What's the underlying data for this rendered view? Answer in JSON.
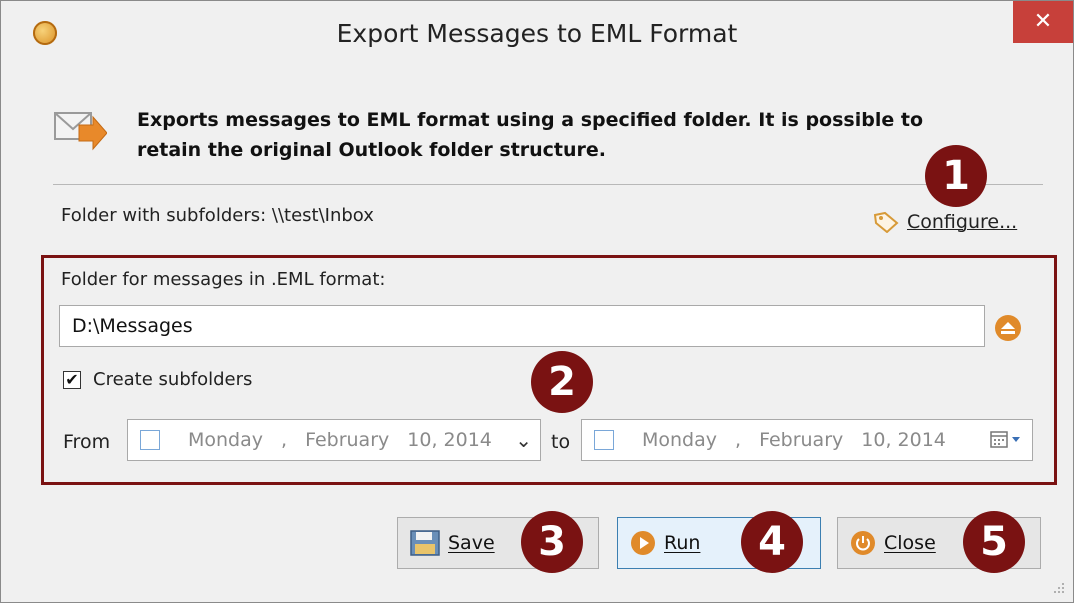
{
  "window": {
    "title": "Export Messages to EML Format",
    "close_glyph": "✕"
  },
  "header": {
    "description": "Exports messages to EML format using a specified folder. It is possible to retain the original Outlook folder structure."
  },
  "source": {
    "folder_label": "Folder with subfolders: \\\\test\\Inbox",
    "configure_label": "Configure..."
  },
  "output": {
    "folder_label": "Folder for messages in .EML format:",
    "folder_value": "D:\\Messages",
    "create_subfolders_label": "Create subfolders",
    "create_subfolders_checked": true,
    "check_glyph": "✔"
  },
  "date_range": {
    "from_label": "From",
    "to_label": "to",
    "from": {
      "weekday": "Monday",
      "sep": ",",
      "month": "February",
      "day_year": "10, 2014"
    },
    "to": {
      "weekday": "Monday",
      "sep": ",",
      "month": "February",
      "day_year": "10, 2014"
    },
    "from_arrow": "⌄"
  },
  "buttons": {
    "save": "Save",
    "run": "Run",
    "close": "Close"
  },
  "badges": [
    "1",
    "2",
    "3",
    "4",
    "5"
  ],
  "colors": {
    "badge": "#7a1212",
    "close_button": "#c7403a",
    "accent_orange": "#e08a2a",
    "focus_blue": "#3c7fb1"
  },
  "icons": [
    "app-envelope-icon",
    "export-arrow-icon",
    "tag-icon",
    "eject-icon",
    "save-disk-icon",
    "run-play-icon",
    "power-icon",
    "calendar-icon"
  ]
}
